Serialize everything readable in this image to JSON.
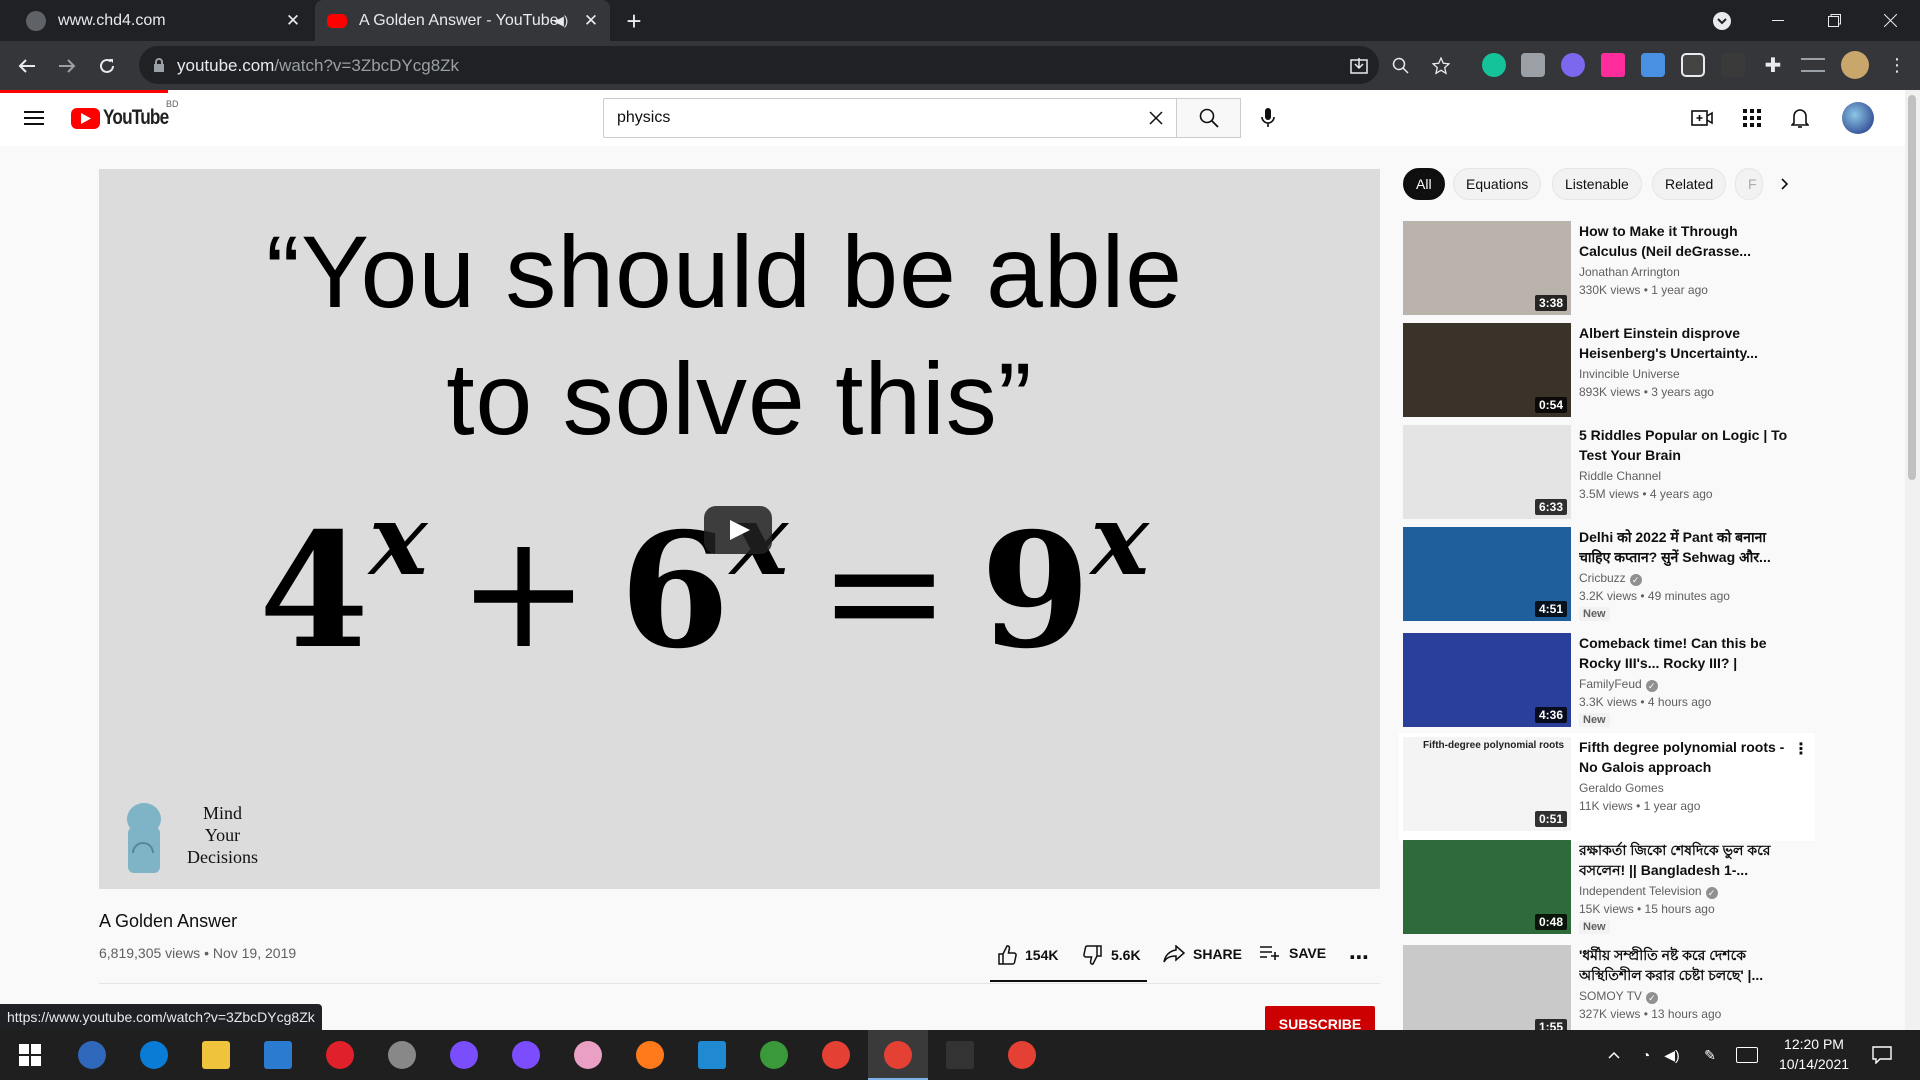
{
  "browser": {
    "tabs": [
      {
        "title": "www.chd4.com"
      },
      {
        "title": "A Golden Answer - YouTube"
      }
    ],
    "url_domain": "youtube.com",
    "url_path": "/watch?v=3ZbcDYcg8Zk",
    "status_url": "https://www.youtube.com/watch?v=3ZbcDYcg8Zk"
  },
  "youtube": {
    "logo_text": "YouTube",
    "country_code": "BD",
    "search_value": "physics",
    "player": {
      "quote_line1": "“You should be able",
      "quote_line2": "to solve this”",
      "equation": {
        "base1": "4",
        "exp": "x",
        "plus": "+",
        "base2": "6",
        "equals": "=",
        "base3": "9"
      },
      "watermark": [
        "Mind",
        "Your",
        "Decisions"
      ]
    },
    "video": {
      "title": "A Golden Answer",
      "meta": "6,819,305 views • Nov 19, 2019",
      "likes": "154K",
      "dislikes": "5.6K",
      "share": "SHARE",
      "save": "SAVE",
      "subscribe": "SUBSCRIBE"
    },
    "chips": [
      "All",
      "Equations",
      "Listenable",
      "Related",
      "F"
    ],
    "recommendations": [
      {
        "title": "How to Make it Through Calculus (Neil deGrasse...",
        "channel": "Jonathan Arrington",
        "views": "330K views • 1 year ago",
        "duration": "3:38",
        "color": "#b9b3ac"
      },
      {
        "title": "Albert Einstein disprove Heisenberg's Uncertainty...",
        "channel": "Invincible Universe",
        "views": "893K views • 3 years ago",
        "duration": "0:54",
        "color": "#3a3329"
      },
      {
        "title": "5 Riddles Popular on Logic | To Test Your Brain",
        "channel": "Riddle Channel",
        "views": "3.5M views • 4 years ago",
        "duration": "6:33",
        "color": "#e4e4e4"
      },
      {
        "title": "Delhi को 2022 में Pant को बनाना चाहिए कप्तान? सुनें Sehwag और...",
        "channel": "Cricbuzz",
        "views": "3.2K views • 49 minutes ago",
        "duration": "4:51",
        "badge": "New",
        "color": "#1e5f9c"
      },
      {
        "title": "Comeback time! Can this be Rocky III's... Rocky III? | Famil...",
        "channel": "FamilyFeud",
        "views": "3.3K views • 4 hours ago",
        "duration": "4:36",
        "badge": "New",
        "color": "#2a3f9a"
      },
      {
        "title": "Fifth degree polynomial roots - No Galois approach",
        "channel": "Geraldo Gomes",
        "views": "11K views • 1 year ago",
        "duration": "0:51",
        "thumb_text": "Fifth-degree polynomial roots",
        "color": "#f4f4f4"
      },
      {
        "title": "রক্ষাকর্তা জিকো শেষদিকে ভুল করে বসলেন! || Bangladesh 1-...",
        "channel": "Independent Television",
        "views": "15K views • 15 hours ago",
        "duration": "0:48",
        "badge": "New",
        "color": "#2f6b3a"
      },
      {
        "title": "'ধর্মীয় সম্প্রীতি নষ্ট করে দেশকে অস্থিতিশীল করার চেষ্টা চলছে' |...",
        "channel": "SOMOY TV",
        "views": "327K views • 13 hours ago",
        "duration": "1:55",
        "color": "#c9c9c9"
      }
    ]
  },
  "taskbar": {
    "time": "12:20 PM",
    "date": "10/14/2021",
    "apps": [
      "windows-start",
      "qbittorrent",
      "edge",
      "file-explorer",
      "mail",
      "opera",
      "satellite",
      "messenger",
      "github",
      "paint",
      "firefox",
      "vscode",
      "earth",
      "chrome",
      "chrome-active",
      "terminal",
      "chrome-profile"
    ]
  },
  "colors": {
    "brand": "#ff0000",
    "chrome_dark": "#202124",
    "chrome_toolbar": "#35363a",
    "taskbar": "#1f1f1f"
  }
}
